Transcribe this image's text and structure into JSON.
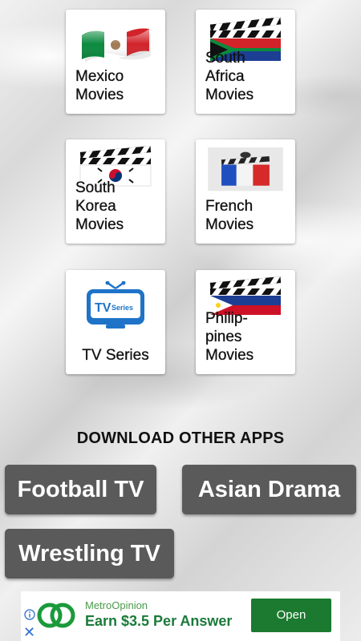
{
  "cards": [
    {
      "label": "Mexico\nMovies",
      "icon": "mexico-flag-icon"
    },
    {
      "label": "South\nAfrica\nMovies",
      "icon": "south-africa-clapperboard-icon"
    },
    {
      "label": "South\nKorea\nMovies",
      "icon": "south-korea-clapperboard-icon"
    },
    {
      "label": "French\nMovies",
      "icon": "france-clapperboard-icon"
    },
    {
      "label": "TV Series",
      "icon": "tv-series-icon",
      "tv_icon_text": "TV Series"
    },
    {
      "label": "Philip-\npines\nMovies",
      "icon": "philippines-clapperboard-icon"
    }
  ],
  "other_apps": {
    "title": "DOWNLOAD OTHER APPS",
    "buttons": [
      "Football TV",
      "Asian Drama",
      "Wrestling TV"
    ]
  },
  "ad": {
    "brand": "MetroOpinion",
    "headline": "Earn $3.5 Per Answer",
    "cta": "Open",
    "close": "✕"
  },
  "colors": {
    "button_bg": "#5a5a5a",
    "ad_green": "#1b7a2f"
  }
}
